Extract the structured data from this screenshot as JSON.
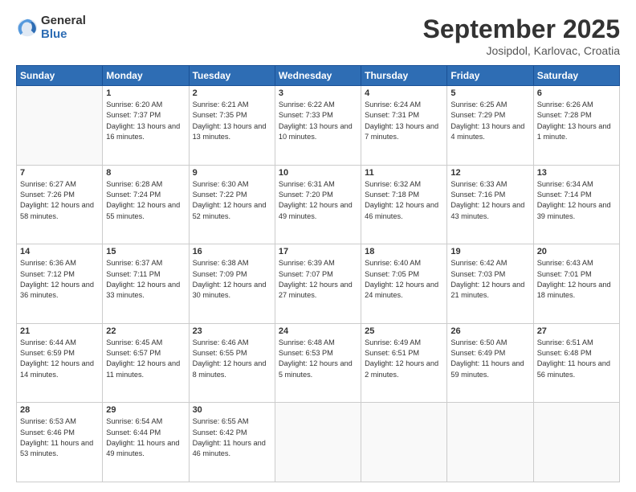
{
  "logo": {
    "general": "General",
    "blue": "Blue"
  },
  "header": {
    "month": "September 2025",
    "location": "Josipdol, Karlovac, Croatia"
  },
  "weekdays": [
    "Sunday",
    "Monday",
    "Tuesday",
    "Wednesday",
    "Thursday",
    "Friday",
    "Saturday"
  ],
  "weeks": [
    [
      {
        "day": "",
        "sunrise": "",
        "sunset": "",
        "daylight": ""
      },
      {
        "day": "1",
        "sunrise": "Sunrise: 6:20 AM",
        "sunset": "Sunset: 7:37 PM",
        "daylight": "Daylight: 13 hours and 16 minutes."
      },
      {
        "day": "2",
        "sunrise": "Sunrise: 6:21 AM",
        "sunset": "Sunset: 7:35 PM",
        "daylight": "Daylight: 13 hours and 13 minutes."
      },
      {
        "day": "3",
        "sunrise": "Sunrise: 6:22 AM",
        "sunset": "Sunset: 7:33 PM",
        "daylight": "Daylight: 13 hours and 10 minutes."
      },
      {
        "day": "4",
        "sunrise": "Sunrise: 6:24 AM",
        "sunset": "Sunset: 7:31 PM",
        "daylight": "Daylight: 13 hours and 7 minutes."
      },
      {
        "day": "5",
        "sunrise": "Sunrise: 6:25 AM",
        "sunset": "Sunset: 7:29 PM",
        "daylight": "Daylight: 13 hours and 4 minutes."
      },
      {
        "day": "6",
        "sunrise": "Sunrise: 6:26 AM",
        "sunset": "Sunset: 7:28 PM",
        "daylight": "Daylight: 13 hours and 1 minute."
      }
    ],
    [
      {
        "day": "7",
        "sunrise": "Sunrise: 6:27 AM",
        "sunset": "Sunset: 7:26 PM",
        "daylight": "Daylight: 12 hours and 58 minutes."
      },
      {
        "day": "8",
        "sunrise": "Sunrise: 6:28 AM",
        "sunset": "Sunset: 7:24 PM",
        "daylight": "Daylight: 12 hours and 55 minutes."
      },
      {
        "day": "9",
        "sunrise": "Sunrise: 6:30 AM",
        "sunset": "Sunset: 7:22 PM",
        "daylight": "Daylight: 12 hours and 52 minutes."
      },
      {
        "day": "10",
        "sunrise": "Sunrise: 6:31 AM",
        "sunset": "Sunset: 7:20 PM",
        "daylight": "Daylight: 12 hours and 49 minutes."
      },
      {
        "day": "11",
        "sunrise": "Sunrise: 6:32 AM",
        "sunset": "Sunset: 7:18 PM",
        "daylight": "Daylight: 12 hours and 46 minutes."
      },
      {
        "day": "12",
        "sunrise": "Sunrise: 6:33 AM",
        "sunset": "Sunset: 7:16 PM",
        "daylight": "Daylight: 12 hours and 43 minutes."
      },
      {
        "day": "13",
        "sunrise": "Sunrise: 6:34 AM",
        "sunset": "Sunset: 7:14 PM",
        "daylight": "Daylight: 12 hours and 39 minutes."
      }
    ],
    [
      {
        "day": "14",
        "sunrise": "Sunrise: 6:36 AM",
        "sunset": "Sunset: 7:12 PM",
        "daylight": "Daylight: 12 hours and 36 minutes."
      },
      {
        "day": "15",
        "sunrise": "Sunrise: 6:37 AM",
        "sunset": "Sunset: 7:11 PM",
        "daylight": "Daylight: 12 hours and 33 minutes."
      },
      {
        "day": "16",
        "sunrise": "Sunrise: 6:38 AM",
        "sunset": "Sunset: 7:09 PM",
        "daylight": "Daylight: 12 hours and 30 minutes."
      },
      {
        "day": "17",
        "sunrise": "Sunrise: 6:39 AM",
        "sunset": "Sunset: 7:07 PM",
        "daylight": "Daylight: 12 hours and 27 minutes."
      },
      {
        "day": "18",
        "sunrise": "Sunrise: 6:40 AM",
        "sunset": "Sunset: 7:05 PM",
        "daylight": "Daylight: 12 hours and 24 minutes."
      },
      {
        "day": "19",
        "sunrise": "Sunrise: 6:42 AM",
        "sunset": "Sunset: 7:03 PM",
        "daylight": "Daylight: 12 hours and 21 minutes."
      },
      {
        "day": "20",
        "sunrise": "Sunrise: 6:43 AM",
        "sunset": "Sunset: 7:01 PM",
        "daylight": "Daylight: 12 hours and 18 minutes."
      }
    ],
    [
      {
        "day": "21",
        "sunrise": "Sunrise: 6:44 AM",
        "sunset": "Sunset: 6:59 PM",
        "daylight": "Daylight: 12 hours and 14 minutes."
      },
      {
        "day": "22",
        "sunrise": "Sunrise: 6:45 AM",
        "sunset": "Sunset: 6:57 PM",
        "daylight": "Daylight: 12 hours and 11 minutes."
      },
      {
        "day": "23",
        "sunrise": "Sunrise: 6:46 AM",
        "sunset": "Sunset: 6:55 PM",
        "daylight": "Daylight: 12 hours and 8 minutes."
      },
      {
        "day": "24",
        "sunrise": "Sunrise: 6:48 AM",
        "sunset": "Sunset: 6:53 PM",
        "daylight": "Daylight: 12 hours and 5 minutes."
      },
      {
        "day": "25",
        "sunrise": "Sunrise: 6:49 AM",
        "sunset": "Sunset: 6:51 PM",
        "daylight": "Daylight: 12 hours and 2 minutes."
      },
      {
        "day": "26",
        "sunrise": "Sunrise: 6:50 AM",
        "sunset": "Sunset: 6:49 PM",
        "daylight": "Daylight: 11 hours and 59 minutes."
      },
      {
        "day": "27",
        "sunrise": "Sunrise: 6:51 AM",
        "sunset": "Sunset: 6:48 PM",
        "daylight": "Daylight: 11 hours and 56 minutes."
      }
    ],
    [
      {
        "day": "28",
        "sunrise": "Sunrise: 6:53 AM",
        "sunset": "Sunset: 6:46 PM",
        "daylight": "Daylight: 11 hours and 53 minutes."
      },
      {
        "day": "29",
        "sunrise": "Sunrise: 6:54 AM",
        "sunset": "Sunset: 6:44 PM",
        "daylight": "Daylight: 11 hours and 49 minutes."
      },
      {
        "day": "30",
        "sunrise": "Sunrise: 6:55 AM",
        "sunset": "Sunset: 6:42 PM",
        "daylight": "Daylight: 11 hours and 46 minutes."
      },
      {
        "day": "",
        "sunrise": "",
        "sunset": "",
        "daylight": ""
      },
      {
        "day": "",
        "sunrise": "",
        "sunset": "",
        "daylight": ""
      },
      {
        "day": "",
        "sunrise": "",
        "sunset": "",
        "daylight": ""
      },
      {
        "day": "",
        "sunrise": "",
        "sunset": "",
        "daylight": ""
      }
    ]
  ]
}
